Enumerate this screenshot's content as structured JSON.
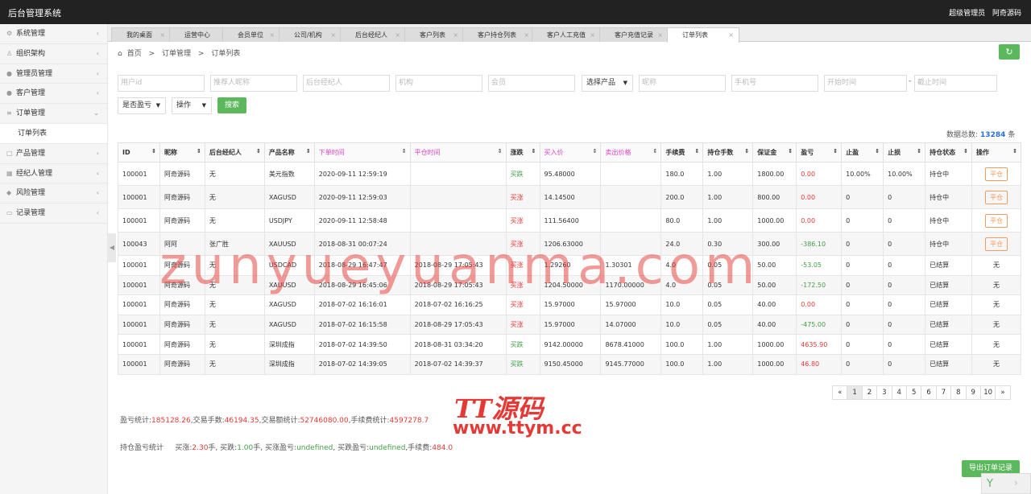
{
  "app": {
    "title": "后台管理系统",
    "user_role": "超级管理员",
    "user_name": "阿奇源码"
  },
  "sidebar": [
    {
      "label": "系统管理",
      "icon": "gear-icon",
      "glyph": "⚙",
      "arrow": "‹"
    },
    {
      "label": "组织架构",
      "icon": "user-icon",
      "glyph": "♙",
      "arrow": "‹"
    },
    {
      "label": "管理员管理",
      "icon": "person-icon",
      "glyph": "●",
      "arrow": "‹"
    },
    {
      "label": "客户管理",
      "icon": "person-icon",
      "glyph": "●",
      "arrow": "‹"
    },
    {
      "label": "订单管理",
      "icon": "list-icon",
      "glyph": "≡",
      "arrow": "⌄"
    },
    {
      "label": "订单列表",
      "sub": true
    },
    {
      "label": "产品管理",
      "icon": "box-icon",
      "glyph": "▢",
      "arrow": "‹"
    },
    {
      "label": "经纪人管理",
      "icon": "grid-icon",
      "glyph": "▦",
      "arrow": "‹"
    },
    {
      "label": "风险管理",
      "icon": "shield-icon",
      "glyph": "◆",
      "arrow": "‹"
    },
    {
      "label": "记录管理",
      "icon": "folder-icon",
      "glyph": "▭",
      "arrow": "‹"
    }
  ],
  "tabs": [
    "我的桌面",
    "运营中心",
    "会员单位",
    "公司/机构",
    "后台经纪人",
    "客户列表",
    "客户持仓列表",
    "客户人工充值",
    "客户充值记录",
    "订单列表"
  ],
  "tab_close": "×",
  "breadcrumb": {
    "home": "首页",
    "sep": ">",
    "level1": "订单管理",
    "level2": "订单列表"
  },
  "filters": {
    "user_id": "用户id",
    "referrer": "推荐人昵称",
    "broker": "后台经纪人",
    "org": "机构",
    "member": "会员",
    "product": "选择产品",
    "nickname": "昵称",
    "phone": "手机号",
    "start": "开始时间",
    "dash": "-",
    "end": "截止时间",
    "profit": "是否盈亏",
    "action": "操作",
    "search": "搜索"
  },
  "total": {
    "label": "数据总数:",
    "count": "13284",
    "unit": "条"
  },
  "table": {
    "headers": [
      "ID",
      "昵称",
      "后台经纪人",
      "产品名称",
      "下单时间",
      "平仓时间",
      "涨跌",
      "买入价",
      "卖出价格",
      "手续费",
      "持仓手数",
      "保证金",
      "盈亏",
      "止盈",
      "止损",
      "持仓状态",
      "操作"
    ],
    "rows": [
      [
        "100001",
        "阿奇源码",
        "无",
        "美元指数",
        "2020-09-11 12:59:19",
        "",
        "买跌",
        "95.48000",
        "",
        "180.0",
        "1.00",
        "1800.00",
        "0.00",
        "10.00%",
        "10.00%",
        "持仓中",
        "平仓"
      ],
      [
        "100001",
        "阿奇源码",
        "无",
        "XAGUSD",
        "2020-09-11 12:59:03",
        "",
        "买涨",
        "14.14500",
        "",
        "200.0",
        "1.00",
        "800.00",
        "0.00",
        "0",
        "0",
        "持仓中",
        "平仓"
      ],
      [
        "100001",
        "阿奇源码",
        "无",
        "USDJPY",
        "2020-09-11 12:58:48",
        "",
        "买涨",
        "111.56400",
        "",
        "80.0",
        "1.00",
        "1000.00",
        "0.00",
        "0",
        "0",
        "持仓中",
        "平仓"
      ],
      [
        "100043",
        "阿阿",
        "张广胜",
        "XAUUSD",
        "2018-08-31 00:07:24",
        "",
        "买涨",
        "1206.63000",
        "",
        "24.0",
        "0.30",
        "300.00",
        "-386.10",
        "0",
        "0",
        "持仓中",
        "平仓"
      ],
      [
        "100001",
        "阿奇源码",
        "无",
        "USDCAD",
        "2018-08-29 16:47:47",
        "2018-08-29 17:05:43",
        "买涨",
        "1.29260",
        "1.30301",
        "4.0",
        "0.05",
        "50.00",
        "-53.05",
        "0",
        "0",
        "已结算",
        "无"
      ],
      [
        "100001",
        "阿奇源码",
        "无",
        "XAUUSD",
        "2018-08-29 16:45:06",
        "2018-08-29 17:05:43",
        "买涨",
        "1204.50000",
        "1170.00000",
        "4.0",
        "0.05",
        "50.00",
        "-172.50",
        "0",
        "0",
        "已结算",
        "无"
      ],
      [
        "100001",
        "阿奇源码",
        "无",
        "XAGUSD",
        "2018-07-02 16:16:01",
        "2018-07-02 16:16:25",
        "买涨",
        "15.97000",
        "15.97000",
        "10.0",
        "0.05",
        "40.00",
        "0.00",
        "0",
        "0",
        "已结算",
        "无"
      ],
      [
        "100001",
        "阿奇源码",
        "无",
        "XAGUSD",
        "2018-07-02 16:15:58",
        "2018-08-29 17:05:43",
        "买涨",
        "15.97000",
        "14.07000",
        "10.0",
        "0.05",
        "40.00",
        "-475.00",
        "0",
        "0",
        "已结算",
        "无"
      ],
      [
        "100001",
        "阿奇源码",
        "无",
        "深圳成指",
        "2018-07-02 14:39:50",
        "2018-08-31 03:34:20",
        "买跌",
        "9142.00000",
        "8678.41000",
        "100.0",
        "1.00",
        "1000.00",
        "4635.90",
        "0",
        "0",
        "已结算",
        "无"
      ],
      [
        "100001",
        "阿奇源码",
        "无",
        "深圳成指",
        "2018-07-02 14:39:05",
        "2018-07-02 14:39:37",
        "买跌",
        "9150.45000",
        "9145.77000",
        "100.0",
        "1.00",
        "1000.00",
        "46.80",
        "0",
        "0",
        "已结算",
        "无"
      ]
    ]
  },
  "pager": [
    "«",
    "1",
    "2",
    "3",
    "4",
    "5",
    "6",
    "7",
    "8",
    "9",
    "10",
    "»"
  ],
  "stats1": {
    "profit_label": "盈亏统计:",
    "profit": "185128.26",
    "sep1": ",交易手数:",
    "lots": "46194.35",
    "sep2": ",交易额统计:",
    "volume": "52746080.00",
    "sep3": ",手续费统计:",
    "fee": "4597278.7"
  },
  "stats2": {
    "label": "持仓盈亏统计",
    "up_label": "买涨:",
    "up": "2.30",
    "up_unit": "手,",
    "down_label": "买跌:",
    "down": "1.00",
    "down_unit": "手,",
    "upp_label": "买涨盈亏:",
    "upp": "undefined",
    "sep": ",",
    "downp_label": "买跌盈亏:",
    "downp": "undefined",
    "fee_label": ",手续费:",
    "fee": "484.0"
  },
  "export": "导出订单记录",
  "watermark": "zunyueyuanma.com",
  "logo": {
    "name": "TT源码",
    "url": "www.ttym.cc"
  },
  "colors": {
    "accent_green": "#5cb85c",
    "profit_red": "#e53935",
    "loss_green": "#43a047",
    "header_pink": "#e040c8"
  }
}
